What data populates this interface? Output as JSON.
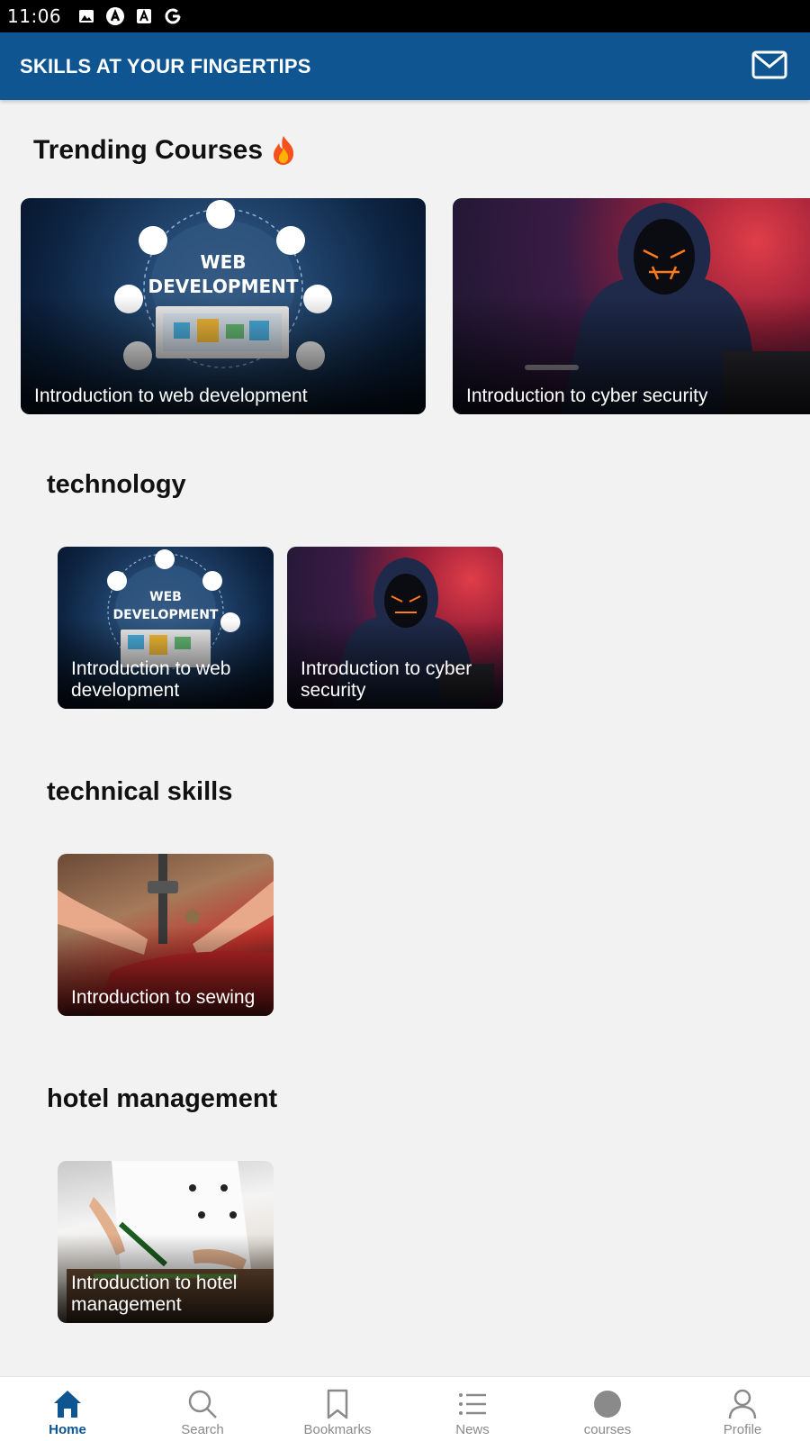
{
  "status_bar": {
    "time": "11:06",
    "icons": [
      "image-icon",
      "a-logo-icon",
      "font-icon",
      "google-icon"
    ]
  },
  "app_bar": {
    "title": "SKILLS AT YOUR FINGERTIPS",
    "action_icon": "mail-icon"
  },
  "trending": {
    "title": "Trending Courses",
    "icon": "flame-icon",
    "courses": [
      {
        "title": "Introduction to web development",
        "image": "web-development"
      },
      {
        "title": "Introduction to cyber security",
        "image": "cyber-security"
      }
    ]
  },
  "categories": [
    {
      "title": "technology",
      "courses": [
        {
          "title": "Introduction to web development",
          "image": "web-development"
        },
        {
          "title": "Introduction to cyber security",
          "image": "cyber-security"
        }
      ]
    },
    {
      "title": "technical skills",
      "courses": [
        {
          "title": "Introduction to sewing",
          "image": "sewing"
        }
      ]
    },
    {
      "title": "hotel management",
      "courses": [
        {
          "title": "Introduction to hotel management",
          "image": "chef"
        }
      ]
    }
  ],
  "bottom_nav": {
    "active": "Home",
    "items": [
      {
        "label": "Home",
        "icon": "home-icon"
      },
      {
        "label": "Search",
        "icon": "search-icon"
      },
      {
        "label": "Bookmarks",
        "icon": "bookmark-icon"
      },
      {
        "label": "News",
        "icon": "list-icon"
      },
      {
        "label": "courses",
        "icon": "circle-icon"
      },
      {
        "label": "Profile",
        "icon": "person-icon"
      }
    ]
  },
  "colors": {
    "primary": "#0e5591",
    "background": "#f2f2f2",
    "inactive_nav": "#8a8a8a"
  }
}
